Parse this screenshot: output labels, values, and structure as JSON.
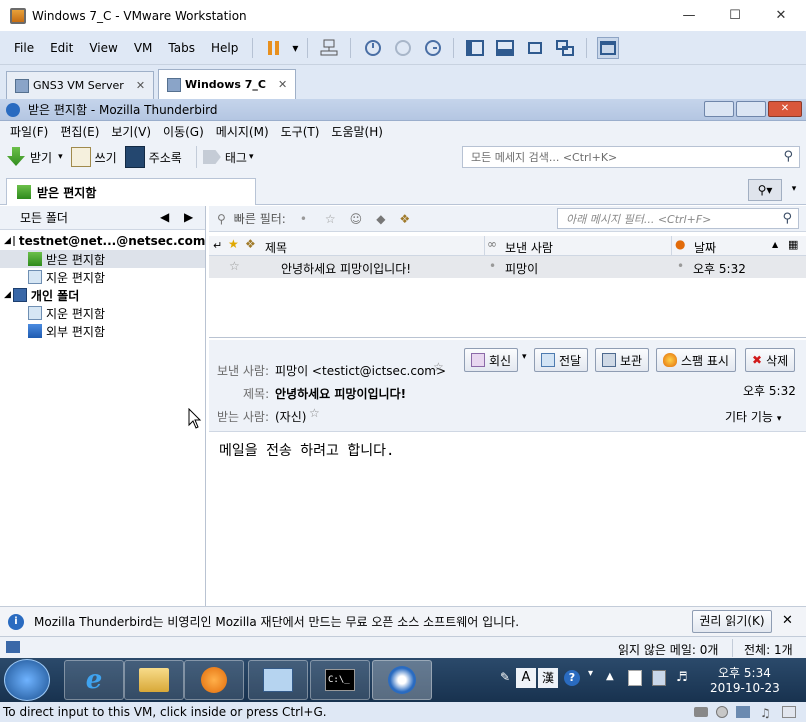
{
  "vmware": {
    "title": "Windows 7_C - VMware Workstation",
    "menu": [
      "File",
      "Edit",
      "View",
      "VM",
      "Tabs",
      "Help"
    ],
    "tabs": [
      {
        "label": "GNS3 VM Server"
      },
      {
        "label": "Windows 7_C"
      }
    ],
    "status_hint": "To direct input to this VM, click inside or press Ctrl+G."
  },
  "thunderbird": {
    "title": "받은 편지함 - Mozilla Thunderbird",
    "menu": [
      "파일(F)",
      "편집(E)",
      "보기(V)",
      "이동(G)",
      "메시지(M)",
      "도구(T)",
      "도움말(H)"
    ],
    "toolbar": {
      "get": "받기",
      "write": "쓰기",
      "address": "주소록",
      "tag": "태그"
    },
    "search_placeholder": "모든 메세지 검색... <Ctrl+K>",
    "tab_label": "받은 편지함",
    "folder_header": "모든 폴더",
    "folders": {
      "account": "testnet@net...@netsec.com",
      "inbox": "받은 편지함",
      "trash": "지운 편지함",
      "local": "개인 폴더",
      "local_trash": "지운 편지함",
      "outbox": "외부 편지함"
    },
    "quickfilter": {
      "label": "빠른 필터:",
      "placeholder": "아래 메시지 필터... <Ctrl+F>"
    },
    "columns": {
      "subject": "제목",
      "sender": "보낸 사람",
      "date": "날짜"
    },
    "message_row": {
      "subject": "안녕하세요 피망이입니다!",
      "sender": "피망이",
      "date": "오후 5:32"
    },
    "message": {
      "from_label": "보낸 사람:",
      "from_value": "피망이 <testict@ictsec.com>",
      "subject_label": "제목:",
      "subject_value": "안녕하세요 피망이입니다!",
      "to_label": "받는 사람:",
      "to_value": "(자신)",
      "time": "오후 5:32",
      "other_actions": "기타 기능",
      "body": "메일을 전송 하려고 합니다."
    },
    "actions": {
      "reply": "회신",
      "forward": "전달",
      "archive": "보관",
      "junk": "스팸 표시",
      "delete": "삭제"
    },
    "notification": {
      "text": "Mozilla Thunderbird는 비영리인 Mozilla 재단에서 만드는 무료 오픈 소스 소프트웨어 입니다.",
      "button": "권리 읽기(K)"
    },
    "status": {
      "unread": "읽지 않은 메일: 0개",
      "total": "전체: 1개"
    }
  },
  "taskbar": {
    "ime": "A",
    "ime2": "漢",
    "time": "오후 5:34",
    "date": "2019-10-23"
  },
  "colors": {
    "accent": "#1c5fb7",
    "vm_chrome": "#dfe8f5",
    "tb_chrome": "#eef2f8",
    "taskbar": "#1f3c5d"
  }
}
